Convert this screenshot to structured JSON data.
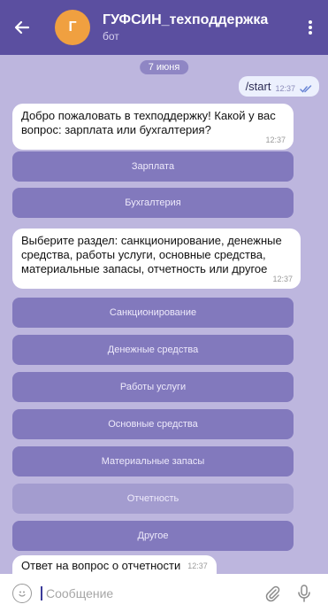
{
  "header": {
    "title": "ГУФСИН_техподдержка",
    "subtitle": "бот",
    "avatar_letter": "Г",
    "back_icon": "arrow-left-icon",
    "menu_icon": "kebab-menu-icon"
  },
  "chat": {
    "date_chip": "7 июня",
    "outgoing": {
      "text": "/start",
      "time": "12:37"
    },
    "messages": [
      {
        "text": "Добро пожаловать в техподдержку! Какой у вас вопрос: зарплата или бухгалтерия?",
        "time": "12:37"
      },
      {
        "text": "Выберите раздел: санкционирование, денежные средства, работы услуги, основные средства, материальные запасы, отчетность или другое",
        "time": "12:37"
      },
      {
        "text": "Ответ на вопрос о отчетности",
        "time": "12:37"
      }
    ],
    "keyboard_1": [
      "Зарплата",
      "Бухгалтерия"
    ],
    "keyboard_2": [
      "Санкционирование",
      "Денежные средства",
      "Работы услуги",
      "Основные средства",
      "Материальные запасы",
      "Отчетность",
      "Другое"
    ]
  },
  "composer": {
    "placeholder": "Сообщение",
    "emoji_icon": "smile-icon",
    "attach_icon": "paperclip-icon",
    "mic_icon": "microphone-icon"
  },
  "colors": {
    "header": "#5b4fa0",
    "chat_bg": "#bdb6de",
    "keyboard_button": "#8279bd",
    "avatar": "#f0a040"
  }
}
